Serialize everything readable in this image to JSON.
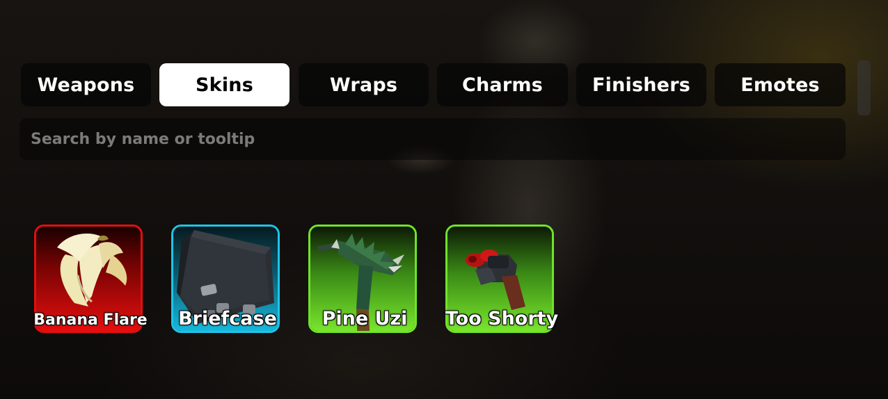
{
  "tabs": [
    {
      "label": "Weapons",
      "active": false
    },
    {
      "label": "Skins",
      "active": true
    },
    {
      "label": "Wraps",
      "active": false
    },
    {
      "label": "Charms",
      "active": false
    },
    {
      "label": "Finishers",
      "active": false
    },
    {
      "label": "Emotes",
      "active": false
    }
  ],
  "search": {
    "placeholder": "Search by name or tooltip",
    "value": ""
  },
  "items": [
    {
      "name": "Banana Flare",
      "icon": "banana-flare-icon",
      "rarity_color": "#e30f0f"
    },
    {
      "name": "Briefcase",
      "icon": "briefcase-icon",
      "rarity_color": "#1fc4e8"
    },
    {
      "name": "Pine Uzi",
      "icon": "pine-uzi-icon",
      "rarity_color": "#6fe32b"
    },
    {
      "name": "Too Shorty",
      "icon": "too-shorty-icon",
      "rarity_color": "#6fe32b"
    }
  ]
}
